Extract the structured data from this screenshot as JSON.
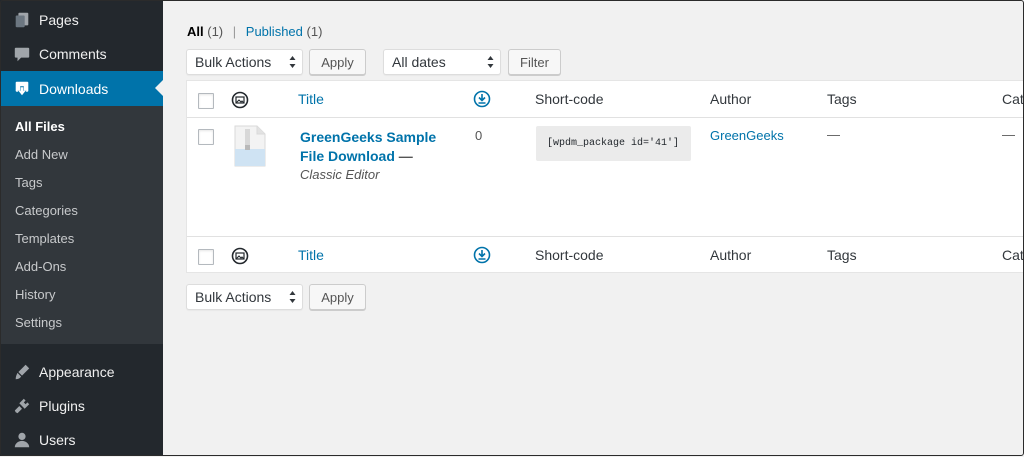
{
  "sidebar": {
    "top_items": [
      {
        "label": "Pages",
        "icon": "pages-icon"
      },
      {
        "label": "Comments",
        "icon": "comments-icon"
      },
      {
        "label": "Downloads",
        "icon": "downloads-icon"
      }
    ],
    "submenu": [
      "All Files",
      "Add New",
      "Tags",
      "Categories",
      "Templates",
      "Add-Ons",
      "History",
      "Settings"
    ],
    "bottom_items": [
      {
        "label": "Appearance",
        "icon": "appearance-icon"
      },
      {
        "label": "Plugins",
        "icon": "plugins-icon"
      },
      {
        "label": "Users",
        "icon": "users-icon"
      }
    ]
  },
  "views": {
    "all_label": "All",
    "all_count": "(1)",
    "separator": "|",
    "published_label": "Published",
    "published_count": "(1)"
  },
  "top_actions": {
    "bulk_actions": "Bulk Actions",
    "apply": "Apply",
    "dates": "All dates",
    "filter": "Filter"
  },
  "bottom_actions": {
    "bulk_actions": "Bulk Actions",
    "apply": "Apply"
  },
  "table": {
    "columns": {
      "title": "Title",
      "shortcode": "Short-code",
      "author": "Author",
      "tags": "Tags",
      "categories": "Cat"
    },
    "row": {
      "title": "GreenGeeks Sample File Download",
      "title_suffix": " —",
      "state": "Classic Editor",
      "downloads": "0",
      "shortcode": "[wpdm_package id='41']",
      "author": "GreenGeeks",
      "tags": "—",
      "categories": "—"
    }
  },
  "colors": {
    "sidebar_bg": "#23282d",
    "submenu_bg": "#32373c",
    "active": "#0073aa",
    "link": "#0073aa"
  }
}
